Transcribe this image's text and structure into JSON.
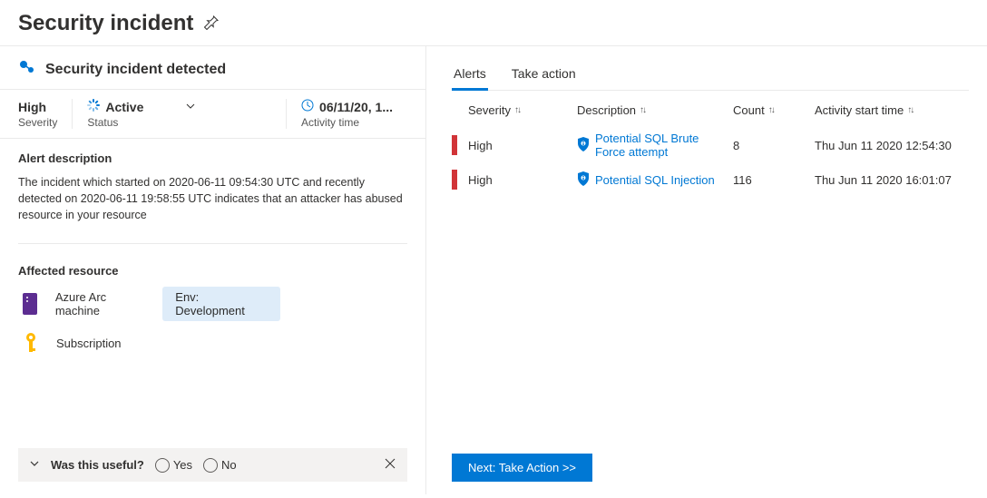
{
  "page_title": "Security incident",
  "detected_title": "Security incident detected",
  "summary": {
    "severity": {
      "value": "High",
      "label": "Severity"
    },
    "status": {
      "value": "Active",
      "label": "Status"
    },
    "time": {
      "value": "06/11/20, 1...",
      "label": "Activity time"
    }
  },
  "alert_description": {
    "heading": "Alert description",
    "body": "The incident which started on 2020-06-11 09:54:30 UTC and recently detected on 2020-06-11 19:58:55 UTC indicates that an attacker has abused resource in your resource"
  },
  "affected": {
    "heading": "Affected resource",
    "resource1": "Azure Arc machine",
    "resource2": "Subscription",
    "tag": "Env: Development"
  },
  "feedback": {
    "question": "Was this useful?",
    "yes": "Yes",
    "no": "No"
  },
  "tabs": {
    "alerts": "Alerts",
    "take_action": "Take action"
  },
  "columns": {
    "severity": "Severity",
    "description": "Description",
    "count": "Count",
    "activity": "Activity start time"
  },
  "rows": [
    {
      "severity": "High",
      "description": "Potential SQL Brute Force attempt",
      "count": "8",
      "activity": "Thu Jun 11 2020 12:54:30"
    },
    {
      "severity": "High",
      "description": "Potential SQL Injection",
      "count": "116",
      "activity": "Thu Jun 11 2020 16:01:07"
    }
  ],
  "next_button": "Next: Take Action >>"
}
